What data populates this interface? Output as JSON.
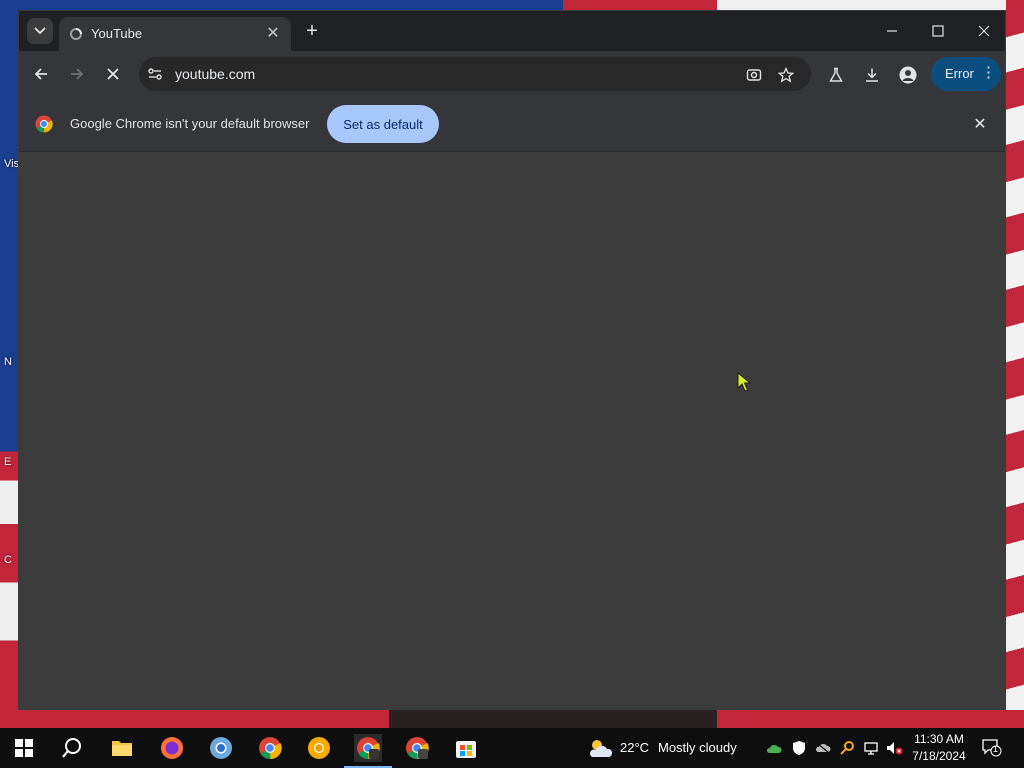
{
  "browser": {
    "tab": {
      "title": "YouTube"
    },
    "address_bar": {
      "url": "youtube.com"
    },
    "profile_error_label": "Error",
    "infobar": {
      "message": "Google Chrome isn't your default browser",
      "button_label": "Set as default"
    },
    "accent_color": "#a8c7fa"
  },
  "desktop": {
    "icon_labels": [
      "Vis",
      "N",
      "E",
      "C"
    ]
  },
  "taskbar": {
    "apps": [
      {
        "name": "file-explorer"
      },
      {
        "name": "firefox"
      },
      {
        "name": "chromium"
      },
      {
        "name": "chrome"
      },
      {
        "name": "chrome-canary"
      },
      {
        "name": "chrome-dev"
      },
      {
        "name": "chrome-beta"
      },
      {
        "name": "microsoft-store"
      }
    ],
    "weather": {
      "temperature": "22°C",
      "condition": "Mostly cloudy"
    },
    "clock": {
      "time": "11:30 AM",
      "date": "7/18/2024"
    },
    "notification_count": "1"
  }
}
